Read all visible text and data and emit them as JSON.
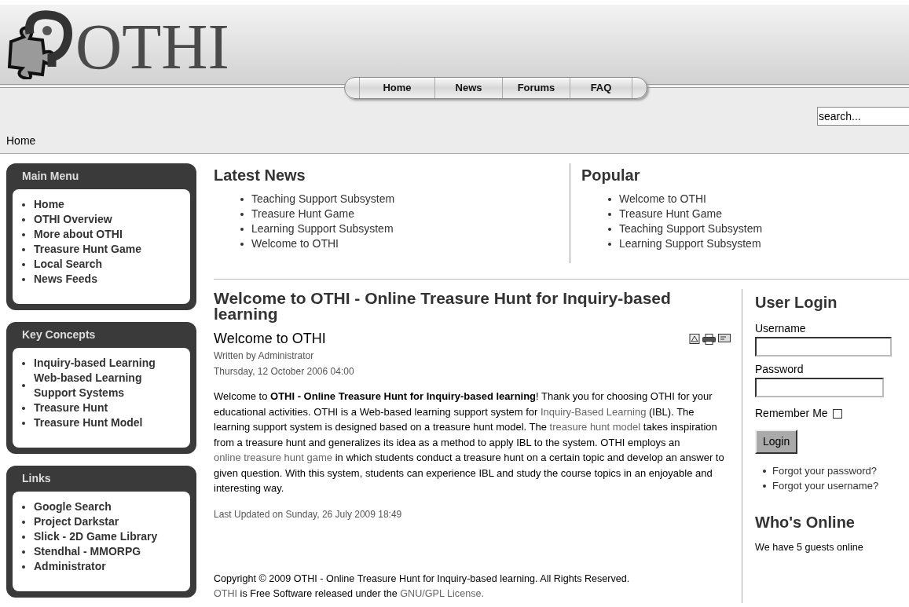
{
  "header": {
    "logo_text": "OTHI"
  },
  "nav": [
    {
      "label": "Home"
    },
    {
      "label": "News"
    },
    {
      "label": "Forums"
    },
    {
      "label": "FAQ"
    }
  ],
  "search": {
    "placeholder": "search..."
  },
  "breadcrumb": "Home",
  "sidebar": [
    {
      "title": "Main Menu",
      "items": [
        "Home",
        "OTHI Overview",
        "More about OTHI",
        "Treasure Hunt Game",
        "Local Search",
        "News Feeds"
      ]
    },
    {
      "title": "Key Concepts",
      "items": [
        "Inquiry-based Learning",
        "Web-based Learning Support Systems",
        "Treasure Hunt",
        "Treasure Hunt Model"
      ]
    },
    {
      "title": "Links",
      "items": [
        "Google Search",
        "Project Darkstar",
        "Slick - 2D Game Library",
        "Stendhal - MMORPG",
        "Administrator"
      ]
    }
  ],
  "latest_news": {
    "title": "Latest News",
    "items": [
      "Teaching Support Subsystem",
      "Treasure Hunt Game",
      "Learning Support Subsystem",
      "Welcome to OTHI"
    ]
  },
  "popular": {
    "title": "Popular",
    "items": [
      "Welcome to OTHI",
      "Treasure Hunt Game",
      "Teaching Support Subsystem",
      "Learning Support Subsystem"
    ]
  },
  "article": {
    "page_title": "Welcome to OTHI - Online Treasure Hunt for Inquiry-based learning",
    "title": "Welcome to OTHI",
    "author": "Written by Administrator",
    "date": "Thursday, 12 October 2006 04:00",
    "body": [
      {
        "kind": "plain",
        "text": "Welcome to "
      },
      {
        "kind": "bold",
        "text": "OTHI - Online Treasure Hunt for Inquiry-based learning"
      },
      {
        "kind": "plain",
        "text": "! Thank you for choosing OTHI for your educational activities. OTHI is a Web-based learning support system for "
      },
      {
        "kind": "link",
        "text": "Inquiry-Based Learning"
      },
      {
        "kind": "plain",
        "text": " (IBL). The learning support system is designed based on a treasure hunt model. The "
      },
      {
        "kind": "link",
        "text": "treasure hunt model"
      },
      {
        "kind": "plain",
        "text": " takes inspiration from a treasure hunt and generalizes its idea as a method to apply IBL to the system. OTHI employs an "
      },
      {
        "kind": "link",
        "text": "online treasure hunt game"
      },
      {
        "kind": "plain",
        "text": " in which students conduct a treasure hunt on a certain topic and develop an answer to given question. With this system, students can experience IBL and study the course topics in an enjoyable and interesting way."
      }
    ],
    "last_updated": "Last Updated on Sunday, 26 July 2009 18:49"
  },
  "footer": {
    "copyright": "Copyright © 2009 OTHI - Online Treasure Hunt for Inquiry-based learning. All Rights Reserved.",
    "license": [
      {
        "kind": "link",
        "text": "OTHI"
      },
      {
        "kind": "plain",
        "text": " is Free Software released under the "
      },
      {
        "kind": "link",
        "text": "GNU/GPL License."
      }
    ]
  },
  "login": {
    "title": "User Login",
    "username_label": "Username",
    "password_label": "Password",
    "remember_label": "Remember Me",
    "remember_checked": false,
    "button": "Login",
    "links": [
      "Forgot your password?",
      "Forgot your username?"
    ]
  },
  "whos_online": {
    "title": "Who's Online",
    "text": "We have 5 guests online"
  }
}
